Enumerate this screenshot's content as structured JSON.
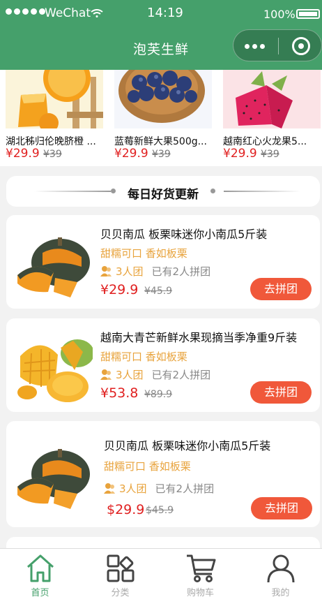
{
  "status_bar": {
    "carrier": "WeChat",
    "time": "14:19",
    "battery": "100%"
  },
  "header": {
    "title": "泡芙生鲜"
  },
  "hot_items": [
    {
      "name": "湖北秭归伦晚脐橙 ...",
      "price": "¥29.9",
      "old_price": "¥39"
    },
    {
      "name": "蓝莓新鲜大果500g...",
      "price": "¥29.9",
      "old_price": "¥39"
    },
    {
      "name": "越南红心火龙果5...",
      "price": "¥29.9",
      "old_price": "¥39"
    }
  ],
  "section": {
    "title": "每日好货更新"
  },
  "group_items": [
    {
      "title": "贝贝南瓜 板栗味迷你小南瓜5斤装",
      "tags": "甜糯可口 香如板栗",
      "group_size": "3人团",
      "joined": "已有2人拼团",
      "price": "¥29.9",
      "old_price": "¥45.9",
      "button": "去拼团"
    },
    {
      "title": "越南大青芒新鲜水果现摘当季净重9斤装",
      "tags": "甜糯可口 香如板栗",
      "group_size": "3人团",
      "joined": "已有2人拼团",
      "price": "¥53.8",
      "old_price": "¥89.9",
      "button": "去拼团"
    },
    {
      "title": "贝贝南瓜 板栗味迷你小南瓜5斤装",
      "tags": "甜糯可口 香如板栗",
      "group_size": "3人团",
      "joined": "已有2人拼团",
      "price": "$29.9",
      "old_price": "$45.9",
      "button": "去拼团"
    }
  ],
  "tabbar": [
    {
      "label": "首页",
      "icon": "home-icon",
      "active": true
    },
    {
      "label": "分类",
      "icon": "category-icon",
      "active": false
    },
    {
      "label": "购物车",
      "icon": "cart-icon",
      "active": false
    },
    {
      "label": "我的",
      "icon": "user-icon",
      "active": false
    }
  ],
  "colors": {
    "brand_green": "#45a06b",
    "price_red": "#e02020",
    "button_orange": "#f0583a",
    "tag_orange": "#e8a33c"
  }
}
